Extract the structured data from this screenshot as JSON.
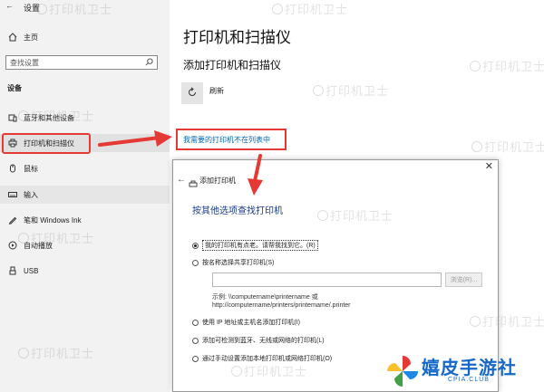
{
  "window": {
    "title": "设置"
  },
  "sidebar": {
    "home": "主页",
    "search_placeholder": "查找设置",
    "section": "设备",
    "items": [
      {
        "label": "蓝牙和其他设备",
        "icon": "bluetooth-icon"
      },
      {
        "label": "打印机和扫描仪",
        "icon": "printer-icon"
      },
      {
        "label": "鼠标",
        "icon": "mouse-icon"
      },
      {
        "label": "输入",
        "icon": "keyboard-icon"
      },
      {
        "label": "笔和 Windows Ink",
        "icon": "pen-icon"
      },
      {
        "label": "自动播放",
        "icon": "autoplay-icon"
      },
      {
        "label": "USB",
        "icon": "usb-icon"
      }
    ]
  },
  "main": {
    "title": "打印机和扫描仪",
    "subtitle": "添加打印机和扫描仪",
    "refresh_label": "刷新",
    "link": "我需要的打印机不在列表中"
  },
  "dialog": {
    "title": "添加打印机",
    "heading": "按其他选项查找打印机",
    "options": [
      "我的打印机有点老。请帮我找到它。(R)",
      "按名称选择共享打印机(S)",
      "使用 IP 地址或主机名添加打印机(I)",
      "添加可检测到蓝牙、无线或网络的打印机(L)",
      "通过手动设置添加本地打印机或网络打印机(O)"
    ],
    "browse_label": "浏览(R)...",
    "example_line1": "示例: \\\\computername\\printername 或",
    "example_line2": "http://computername/printers/printername/.printer"
  },
  "watermark": "打印机卫士",
  "logo": {
    "name": "嬉皮手游社",
    "sub": "CPIA.CLUB"
  },
  "colors": {
    "accent": "#e53935",
    "link": "#0066b4",
    "logo": "#1669c9"
  }
}
